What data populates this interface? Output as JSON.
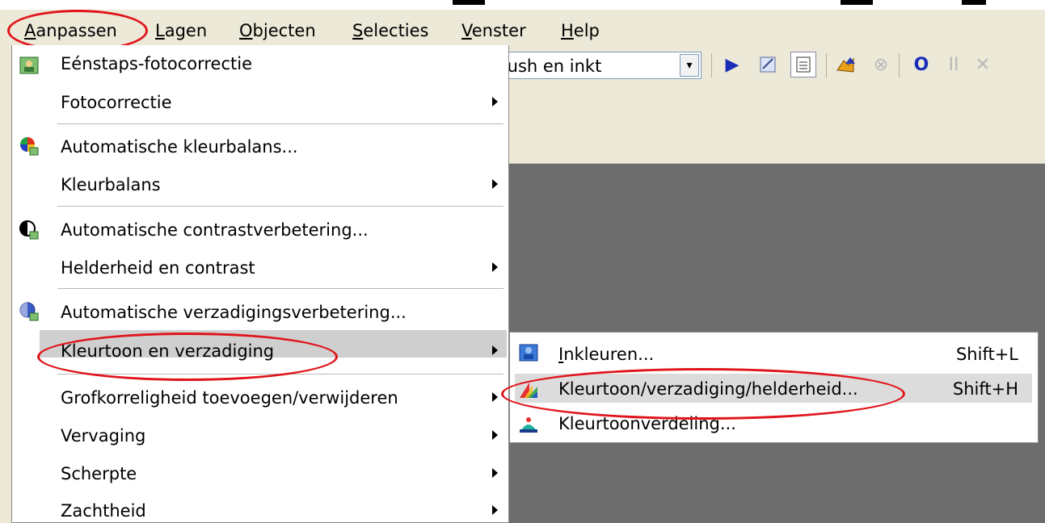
{
  "menubar": {
    "items": [
      {
        "label": "Aanpassen",
        "mnemonic_index": 0
      },
      {
        "label": "Lagen",
        "mnemonic_index": 0
      },
      {
        "label": "Objecten",
        "mnemonic_index": 0
      },
      {
        "label": "Selecties",
        "mnemonic_index": 0
      },
      {
        "label": "Venster",
        "mnemonic_index": 0
      },
      {
        "label": "Help",
        "mnemonic_index": 0
      }
    ]
  },
  "toolbar": {
    "brush_combo_value": "rush en inkt",
    "icons": [
      "play-icon",
      "script-edit-icon",
      "toggle-view-icon",
      "run-script-icon",
      "stop-icon",
      "record-icon",
      "pause-icon",
      "close-icon"
    ]
  },
  "main_menu": {
    "items": [
      {
        "label": "Eénstaps-fotocorrectie",
        "icon": "one-step-photo-fix-icon",
        "submenu": false
      },
      {
        "label": "Fotocorrectie",
        "icon": null,
        "submenu": true
      },
      {
        "label": "Automatische kleurbalans...",
        "icon": "auto-color-balance-icon",
        "submenu": false
      },
      {
        "label": "Kleurbalans",
        "icon": null,
        "submenu": true
      },
      {
        "label": "Automatische contrastverbetering...",
        "icon": "auto-contrast-icon",
        "submenu": false
      },
      {
        "label": "Helderheid en contrast",
        "icon": null,
        "submenu": true
      },
      {
        "label": "Automatische verzadigingsverbetering...",
        "icon": "auto-saturation-icon",
        "submenu": false
      },
      {
        "label": "Kleurtoon en verzadiging",
        "icon": null,
        "submenu": true,
        "highlighted": true
      },
      {
        "label": "Grofkorreligheid toevoegen/verwijderen",
        "icon": null,
        "submenu": true
      },
      {
        "label": "Vervaging",
        "icon": null,
        "submenu": true
      },
      {
        "label": "Scherpte",
        "icon": null,
        "submenu": true
      },
      {
        "label": "Zachtheid",
        "icon": null,
        "submenu": true
      }
    ]
  },
  "sub_menu": {
    "items": [
      {
        "label": "Inkleuren...",
        "shortcut": "Shift+L",
        "icon": "colorize-icon"
      },
      {
        "label": "Kleurtoon/verzadiging/helderheid...",
        "shortcut": "Shift+H",
        "icon": "hue-saturation-icon",
        "highlighted": true
      },
      {
        "label": "Kleurtoonverdeling...",
        "shortcut": "",
        "icon": "hue-map-icon"
      }
    ]
  },
  "colors": {
    "menu_bg": "#ffffff",
    "chrome": "#ece9d8",
    "workspace": "#6d6d6d",
    "annotation": "#e0141a",
    "highlight": "#cfcfcf"
  }
}
